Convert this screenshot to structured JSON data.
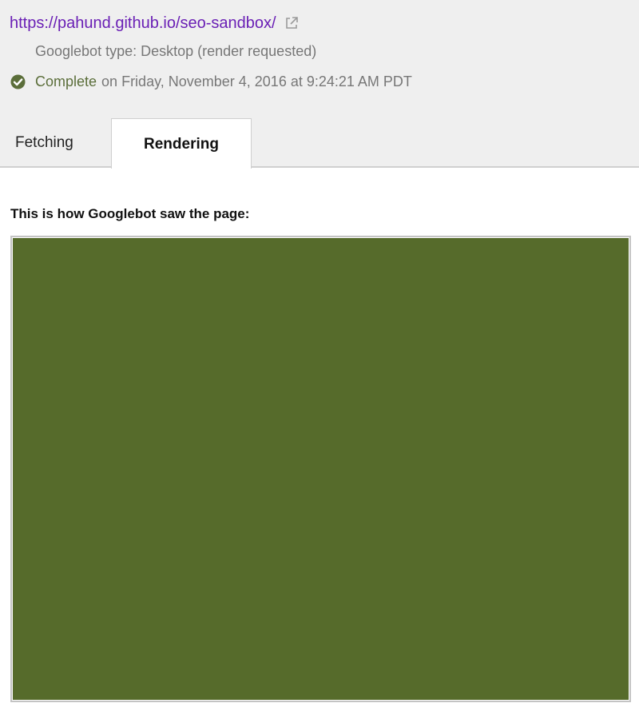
{
  "header": {
    "url": "https://pahund.github.io/seo-sandbox/",
    "external_link_icon": "external-link-icon",
    "googlebot_type": "Googlebot type: Desktop (render requested)",
    "status": {
      "icon": "check-circle-icon",
      "label": "Complete",
      "datetime": "on Friday, November 4, 2016 at 9:24:21 AM PDT"
    }
  },
  "tabs": [
    {
      "label": "Fetching",
      "selected": false
    },
    {
      "label": "Rendering",
      "selected": true
    }
  ],
  "rendering": {
    "heading": "This is how Googlebot saw the page:",
    "preview_color": "#566b2b"
  },
  "colors": {
    "link": "#6a1fb5",
    "status_complete": "#5b6e3a",
    "header_bg": "#efefef"
  }
}
